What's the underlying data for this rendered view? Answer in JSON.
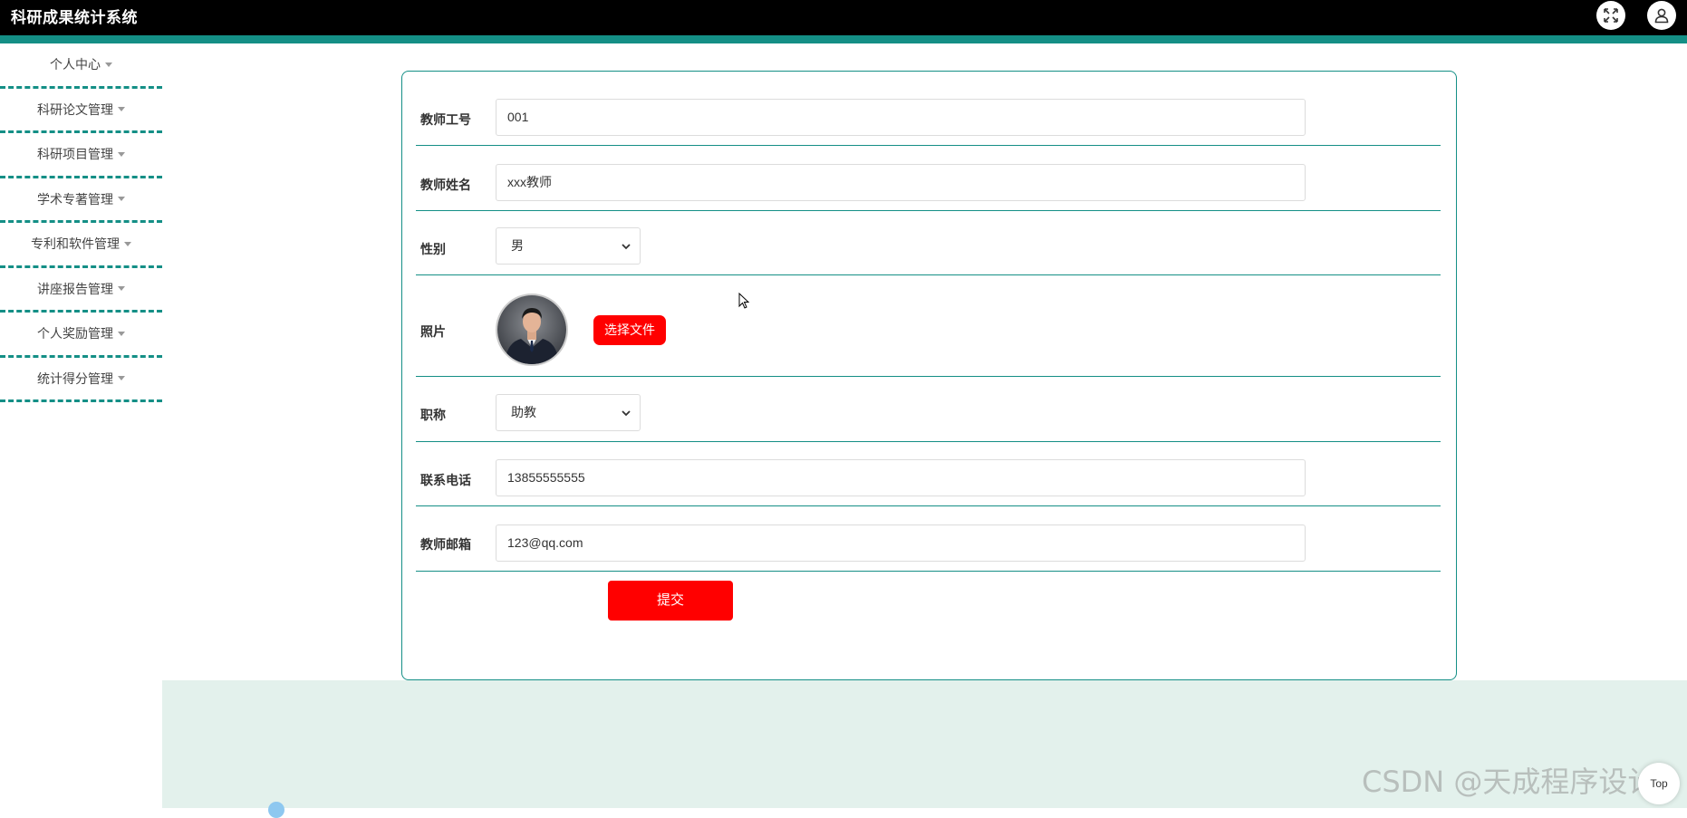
{
  "app": {
    "title": "科研成果统计系统"
  },
  "header": {
    "fullscreen_icon": "fullscreen-icon",
    "user_icon": "user-icon"
  },
  "sidebar": {
    "items": [
      {
        "label": "个人中心"
      },
      {
        "label": "科研论文管理"
      },
      {
        "label": "科研项目管理"
      },
      {
        "label": "学术专著管理"
      },
      {
        "label": "专利和软件管理"
      },
      {
        "label": "讲座报告管理"
      },
      {
        "label": "个人奖励管理"
      },
      {
        "label": "统计得分管理"
      }
    ]
  },
  "form": {
    "teacher_id": {
      "label": "教师工号",
      "value": "001"
    },
    "teacher_name": {
      "label": "教师姓名",
      "value": "xxx教师"
    },
    "gender": {
      "label": "性别",
      "value": "男"
    },
    "photo": {
      "label": "照片",
      "button_label": "选择文件"
    },
    "title": {
      "label": "职称",
      "value": "助教"
    },
    "phone": {
      "label": "联系电话",
      "value": "13855555555"
    },
    "email": {
      "label": "教师邮箱",
      "value": "123@qq.com"
    },
    "submit_label": "提交"
  },
  "footer": {
    "watermark": "CSDN @天成程序设计",
    "top_label": "Top"
  },
  "colors": {
    "header_bg": "#000000",
    "accent": "#148f86",
    "button": "#ff0000",
    "footer_bg": "#e3f1ec"
  }
}
